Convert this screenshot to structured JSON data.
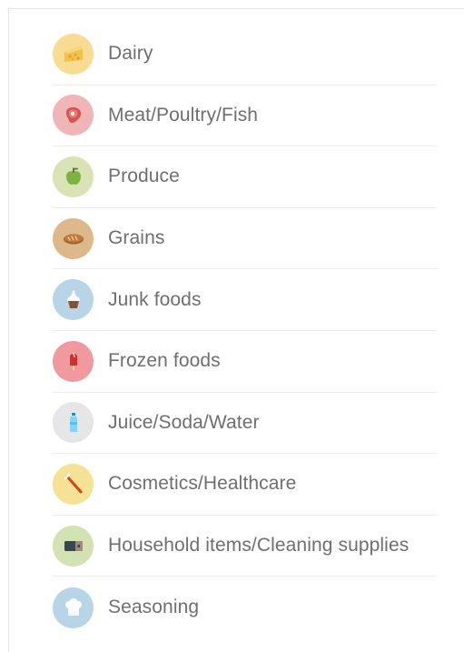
{
  "categories": [
    {
      "label": "Dairy",
      "icon": "cheese-icon",
      "bg": "#f8dc94"
    },
    {
      "label": "Meat/Poultry/Fish",
      "icon": "steak-icon",
      "bg": "#f0b5b6"
    },
    {
      "label": "Produce",
      "icon": "apple-icon",
      "bg": "#d9e3b5"
    },
    {
      "label": "Grains",
      "icon": "bread-icon",
      "bg": "#ddb88a"
    },
    {
      "label": "Junk foods",
      "icon": "cupcake-icon",
      "bg": "#b7d5e6"
    },
    {
      "label": "Frozen foods",
      "icon": "ice-pop-icon",
      "bg": "#f09aa0"
    },
    {
      "label": "Juice/Soda/Water",
      "icon": "water-bottle-icon",
      "bg": "#e6e6e6"
    },
    {
      "label": "Cosmetics/Healthcare",
      "icon": "toothbrush-icon",
      "bg": "#f6e294"
    },
    {
      "label": "Household items/Cleaning supplies",
      "icon": "wallet-icon",
      "bg": "#d3e2b3"
    },
    {
      "label": "Seasoning",
      "icon": "chef-hat-icon",
      "bg": "#b7d5e6"
    }
  ]
}
